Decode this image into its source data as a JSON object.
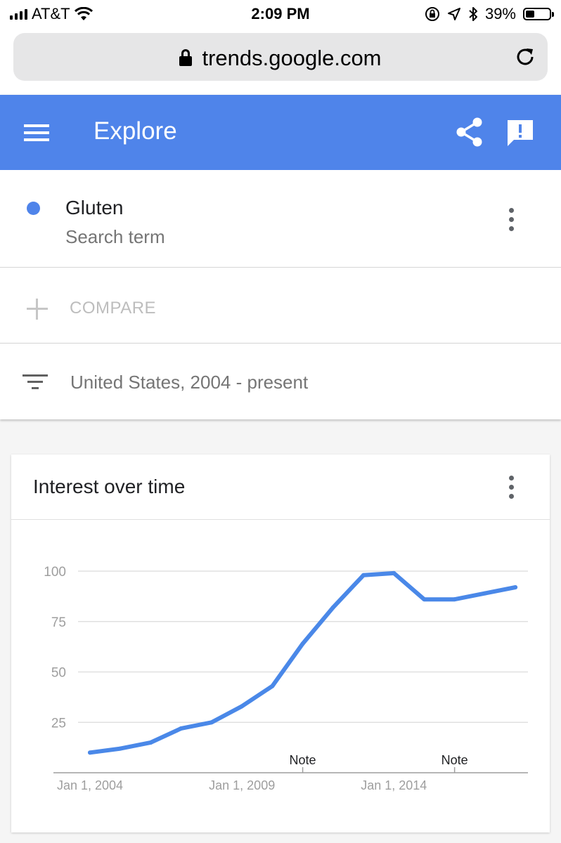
{
  "status_bar": {
    "carrier": "AT&T",
    "time": "2:09 PM",
    "battery": "39%",
    "battery_level": 0.39
  },
  "browser": {
    "url": "trends.google.com"
  },
  "app_bar": {
    "title": "Explore"
  },
  "search_term": {
    "name": "Gluten",
    "subtitle": "Search term",
    "color": "#4f84ea"
  },
  "compare": {
    "label": "COMPARE"
  },
  "filter": {
    "label": "United States, 2004 - present"
  },
  "interest_card": {
    "title": "Interest over time"
  },
  "colors": {
    "accent": "#4f84ea",
    "line": "#4a88e8",
    "grid": "#e0e0e0",
    "axis": "#9e9e9e",
    "tick_text": "#9e9e9e"
  },
  "chart_data": {
    "type": "line",
    "title": "Interest over time",
    "xlabel": "",
    "ylabel": "",
    "xlim": [
      "2004-01-01",
      "2018-06-01"
    ],
    "ylim": [
      0,
      100
    ],
    "yticks": [
      25,
      50,
      75,
      100
    ],
    "xtick_labels": [
      "Jan 1, 2004",
      "Jan 1, 2009",
      "Jan 1, 2014"
    ],
    "xtick_dates": [
      "2004-01-01",
      "2009-01-01",
      "2014-01-01"
    ],
    "grid": true,
    "annotations": [
      {
        "label": "Note",
        "date": "2011-01-01"
      },
      {
        "label": "Note",
        "date": "2016-01-01"
      }
    ],
    "series": [
      {
        "name": "Gluten",
        "x": [
          "2004-01-01",
          "2005-01-01",
          "2006-01-01",
          "2007-01-01",
          "2008-01-01",
          "2009-01-01",
          "2010-01-01",
          "2011-01-01",
          "2012-01-01",
          "2013-01-01",
          "2014-01-01",
          "2015-01-01",
          "2016-01-01",
          "2017-01-01",
          "2018-01-01"
        ],
        "y": [
          10,
          12,
          15,
          22,
          25,
          33,
          43,
          64,
          82,
          98,
          99,
          86,
          86,
          89,
          92
        ]
      }
    ]
  }
}
